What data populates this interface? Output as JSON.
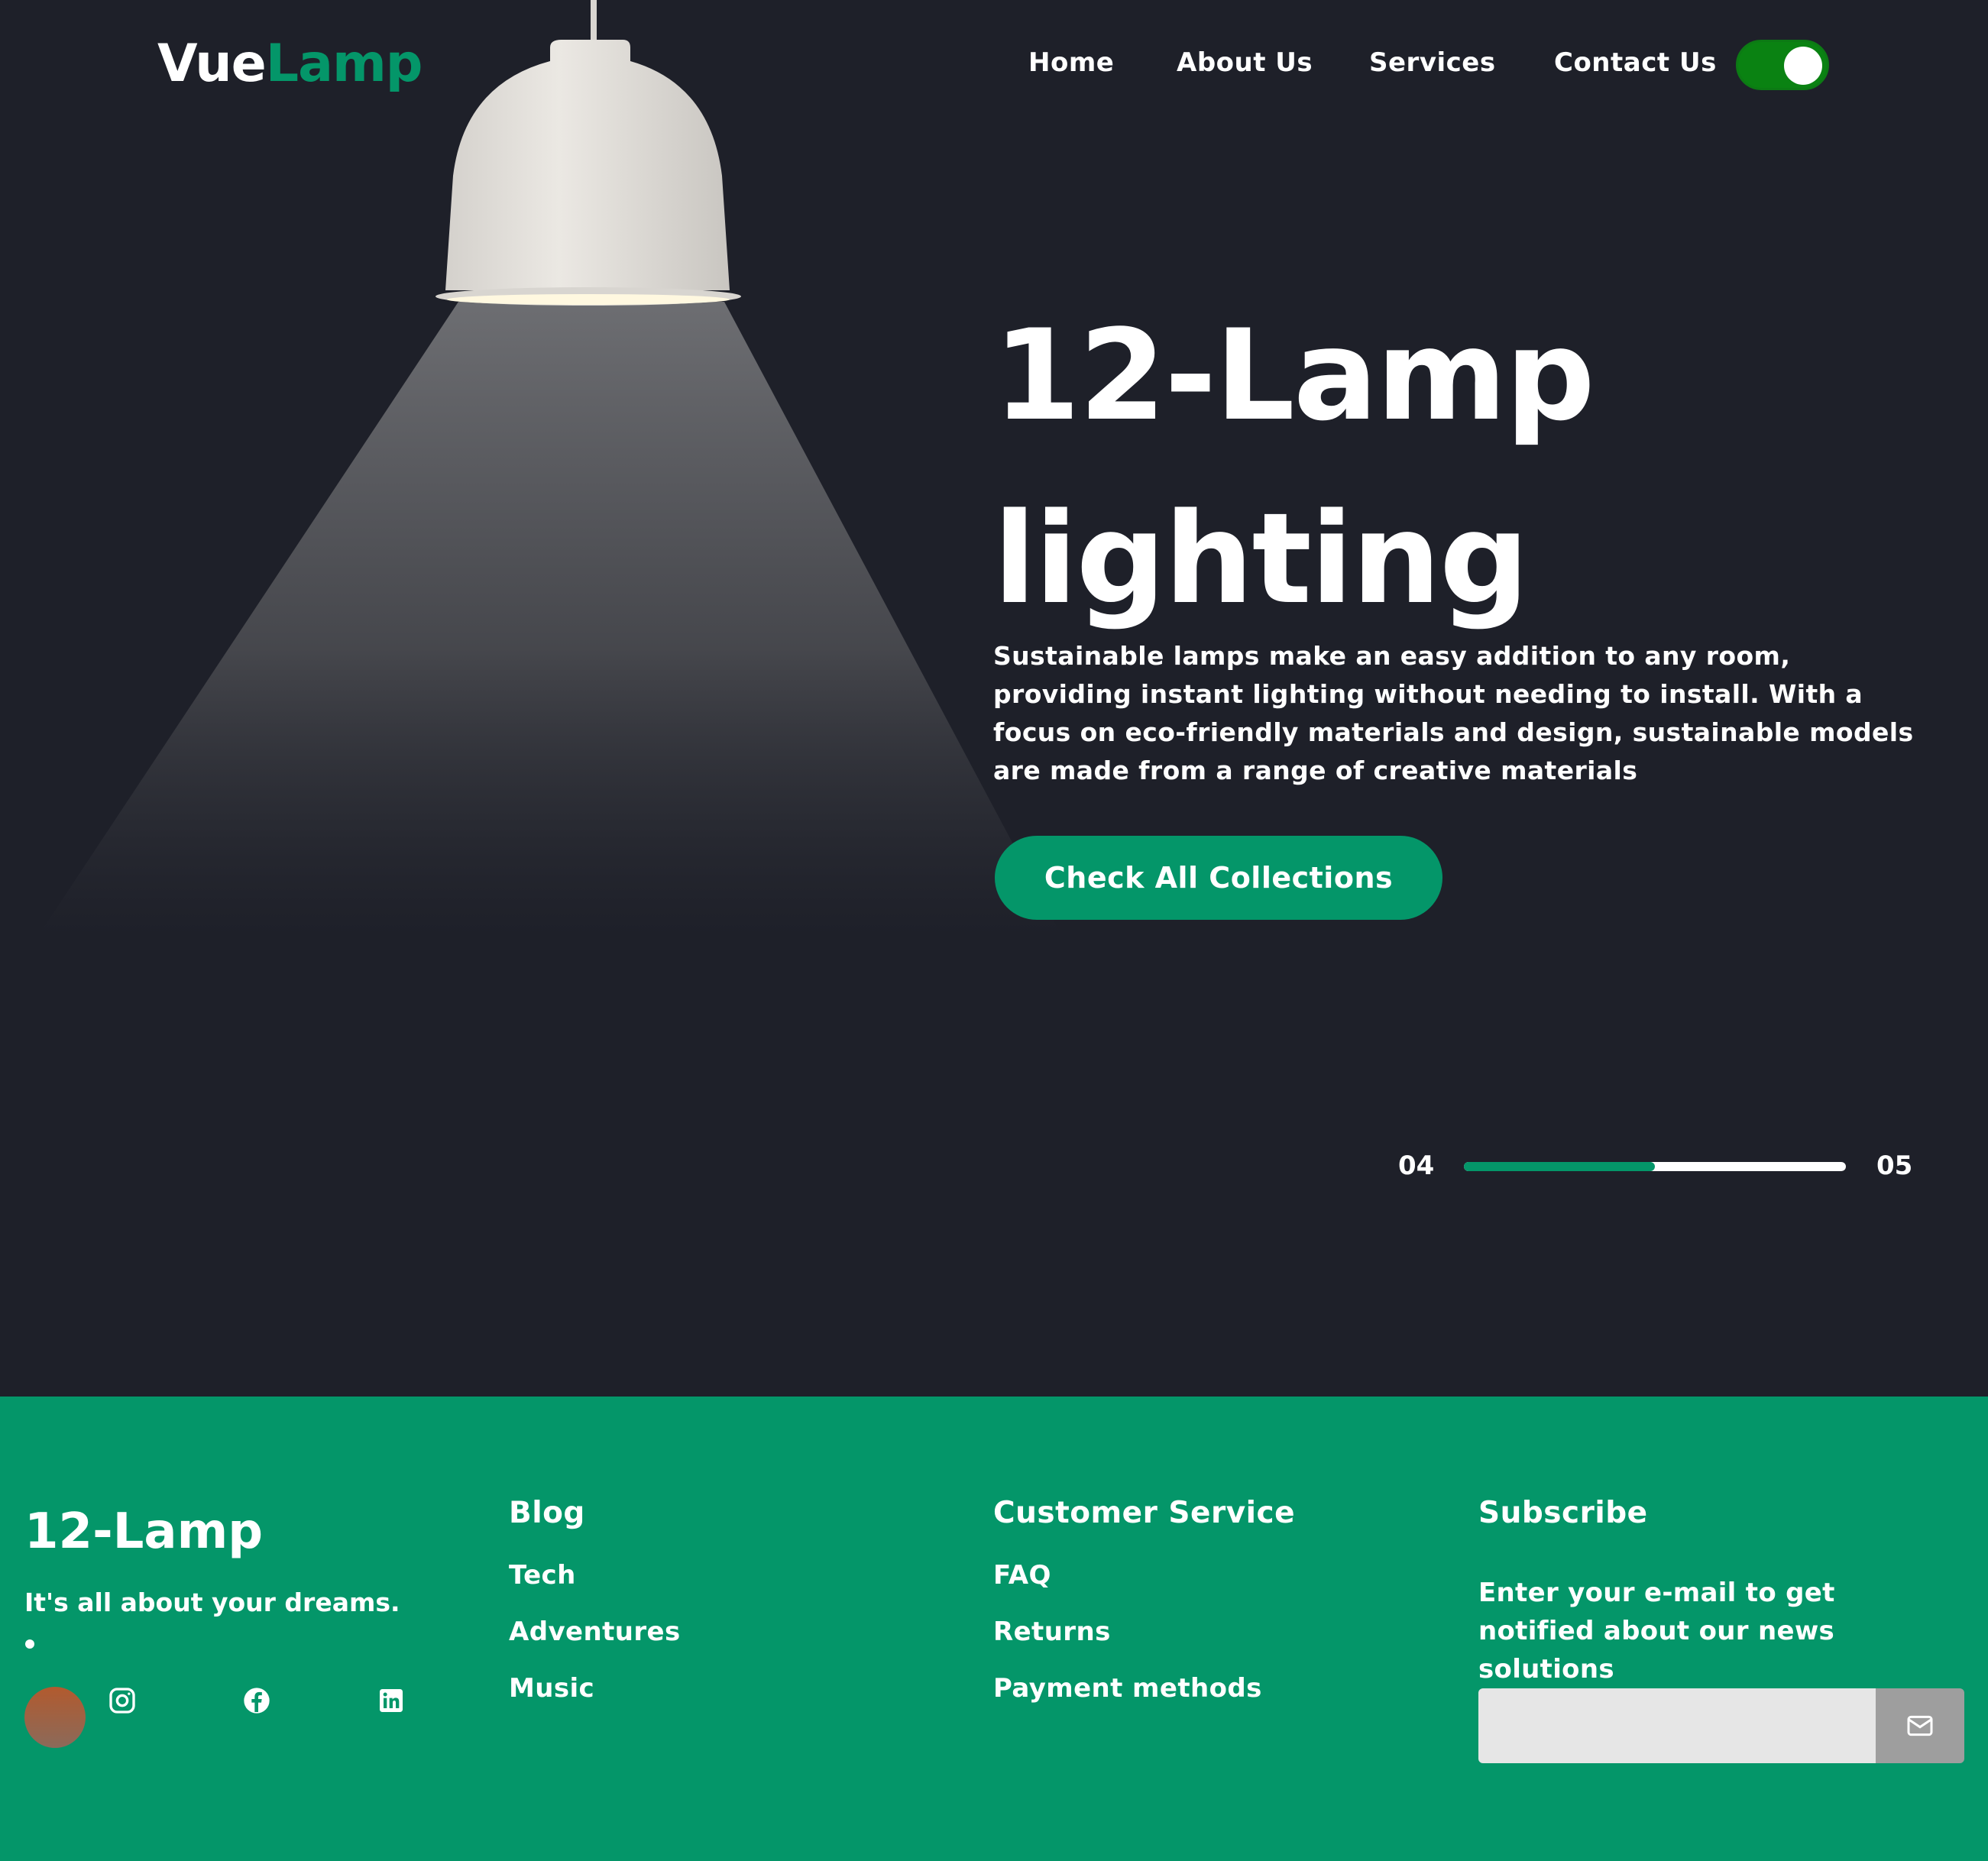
{
  "brand": {
    "part1": "Vue",
    "part2": "Lamp"
  },
  "nav": [
    {
      "label": "Home"
    },
    {
      "label": "About Us"
    },
    {
      "label": "Services"
    },
    {
      "label": "Contact Us"
    }
  ],
  "theme_toggle": {
    "state": "on",
    "color": "#0a8212"
  },
  "hero": {
    "title_line1": "12-Lamp",
    "title_line2": "lighting",
    "description": "Sustainable lamps make an easy addition to any room, providing instant lighting without needing to install. With a focus on eco-friendly materials and design, sustainable models are made from a range of creative materials",
    "cta_label": "Check All Collections"
  },
  "slider": {
    "current": "04",
    "total": "05",
    "progress_fraction": 0.5
  },
  "footer": {
    "brand": "12-Lamp",
    "tagline": "It's all about your dreams.",
    "social": [
      "instagram-icon",
      "facebook-icon",
      "linkedin-icon"
    ],
    "blog": {
      "heading": "Blog",
      "links": [
        "Tech",
        "Adventures",
        "Music"
      ]
    },
    "customer_service": {
      "heading": "Customer Service",
      "links": [
        "FAQ",
        "Returns",
        "Payment methods"
      ]
    },
    "subscribe": {
      "heading": "Subscribe",
      "text": "Enter your e-mail to get notified about our news solutions",
      "placeholder": ""
    }
  },
  "colors": {
    "background": "#1e2029",
    "accent": "#049669",
    "toggle": "#0a8212"
  }
}
